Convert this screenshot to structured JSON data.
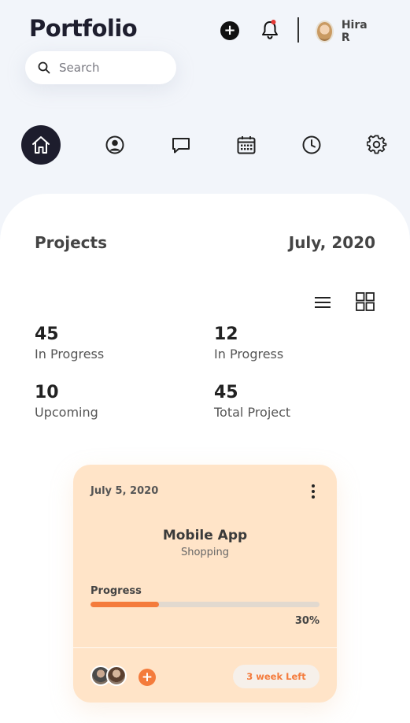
{
  "header": {
    "title": "Portfolio",
    "search_placeholder": "Search",
    "user_name": "Hira R",
    "add_icon": "plus-icon",
    "bell_icon": "bell-icon",
    "notification_dot_color": "#e53935"
  },
  "nav": {
    "items": [
      {
        "name": "home",
        "icon": "home-icon",
        "active": true
      },
      {
        "name": "profile",
        "icon": "user-icon",
        "active": false
      },
      {
        "name": "messages",
        "icon": "chat-icon",
        "active": false
      },
      {
        "name": "calendar",
        "icon": "calendar-icon",
        "active": false
      },
      {
        "name": "history",
        "icon": "clock-icon",
        "active": false
      },
      {
        "name": "settings",
        "icon": "gear-icon",
        "active": false
      }
    ]
  },
  "projects": {
    "title": "Projects",
    "month": "July, 2020",
    "stats": [
      {
        "value": "45",
        "label": "In Progress"
      },
      {
        "value": "12",
        "label": "In Progress"
      },
      {
        "value": "10",
        "label": "Upcoming"
      },
      {
        "value": "45",
        "label": "Total Project"
      }
    ]
  },
  "card": {
    "date": "July 5, 2020",
    "title": "Mobile App",
    "subtitle": "Shopping",
    "progress_label": "Progress",
    "progress_value": 0.3,
    "progress_text": "30%",
    "deadline": "3 week Left",
    "accent_color": "#f47b3c",
    "background_color": "#ffe4c8"
  }
}
